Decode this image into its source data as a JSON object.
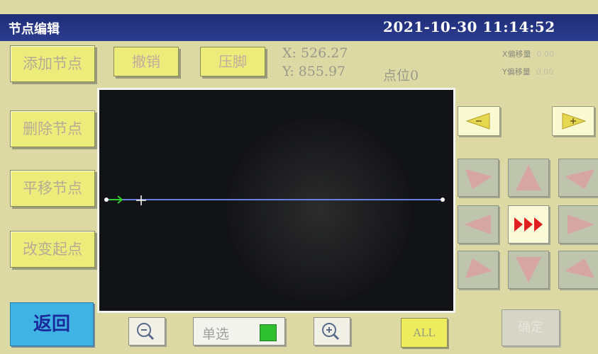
{
  "header": {
    "title": "节点编辑",
    "datetime": "2021-10-30 11:14:52"
  },
  "side_buttons": {
    "add": "添加节点",
    "delete": "删除节点",
    "translate": "平移节点",
    "change_start": "改变起点"
  },
  "toolbar": {
    "undo": "撤销",
    "presser_foot": "压脚"
  },
  "coords": {
    "x": "X: 526.27",
    "y": "Y: 855.97",
    "point": "点位0"
  },
  "offsets": {
    "x_label": "X偏移量",
    "x_value": "0.00",
    "y_label": "Y偏移量",
    "y_value": "0.00"
  },
  "bottom": {
    "back": "返回",
    "select_mode": "单选",
    "select_checked": true,
    "all": "ALL",
    "confirm": "确定"
  },
  "icons": {
    "prev": "left-arrow-icon",
    "next": "right-arrow-icon",
    "zoom_out": "zoom-out-icon",
    "zoom_in": "zoom-in-icon",
    "speed": "triple-chevron-icon"
  },
  "colors": {
    "background": "#dcd9a4",
    "titlebar": "#2a3a8c",
    "button_yellow": "#ecec7a",
    "back_button": "#3fb3e3",
    "select_checked": "#2ec02e",
    "speed_arrow": "#e02020",
    "path_line": "#6a7fe0"
  }
}
